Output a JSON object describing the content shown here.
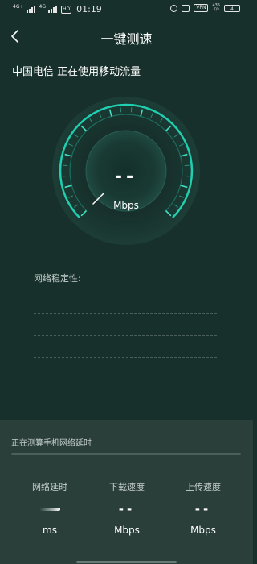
{
  "status_bar": {
    "network_1": "4G+",
    "network_2": "4G",
    "hd_label": "HD",
    "time": "01:19",
    "vpn_label": "VPN",
    "speed_rate_value": "435",
    "speed_rate_unit": "K/s",
    "battery_level": "4"
  },
  "header": {
    "title": "一键测速",
    "back_icon": "chevron-left-icon"
  },
  "carrier_status": "中国电信 正在使用移动流量",
  "gauge": {
    "value": "--",
    "unit": "Mbps",
    "needle_level": 0,
    "accent_color": "#1fcfb0"
  },
  "stability": {
    "label": "网络稳定性:"
  },
  "test_panel": {
    "status_text": "正在测算手机网络延时",
    "progress_fraction": 0.0,
    "metrics": [
      {
        "label": "网络延时",
        "value": "",
        "unit": "ms",
        "loading": true
      },
      {
        "label": "下载速度",
        "value": "--",
        "unit": "Mbps",
        "loading": false
      },
      {
        "label": "上传速度",
        "value": "--",
        "unit": "Mbps",
        "loading": false
      }
    ]
  }
}
